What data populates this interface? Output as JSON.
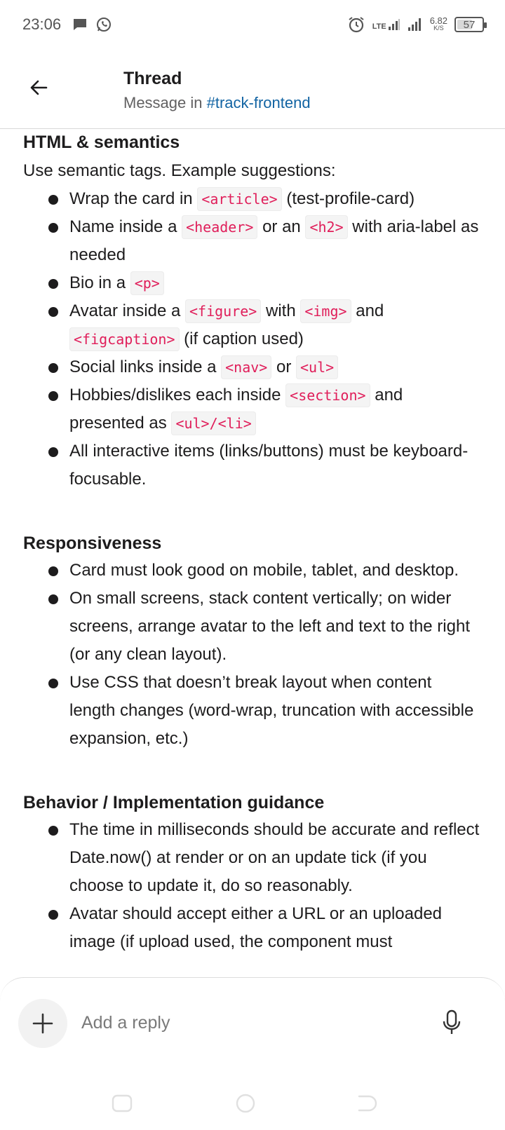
{
  "status_bar": {
    "time": "23:06",
    "network_label": "LTE",
    "net_speed_value": "6.82",
    "net_speed_unit": "K/S",
    "battery": "57",
    "icons": [
      "chat-bubble-icon",
      "whatsapp-icon",
      "alarm-icon",
      "lte-signal-icon",
      "signal-icon",
      "battery-icon"
    ]
  },
  "header": {
    "title": "Thread",
    "subtitle_prefix": "Message in ",
    "channel": "#track-frontend"
  },
  "message": {
    "sections": [
      {
        "title": "HTML & semantics",
        "intro": "Use semantic tags. Example suggestions:",
        "items": [
          {
            "t1": "Wrap the card in ",
            "c1": "<article>",
            "t2": " (test-profile-card)"
          },
          {
            "t1": "Name inside a ",
            "c1": "<header>",
            "t2": " or an ",
            "c2": "<h2>",
            "t3": " with aria-label as needed"
          },
          {
            "t1": "Bio in a ",
            "c1": "<p>"
          },
          {
            "t1": "Avatar inside a ",
            "c1": "<figure>",
            "t2": " with ",
            "c2": "<img>",
            "t3": " and ",
            "c3": "<figcaption>",
            "t4": " (if caption used)"
          },
          {
            "t1": "Social links inside a ",
            "c1": "<nav>",
            "t2": " or ",
            "c2": "<ul>"
          },
          {
            "t1": "Hobbies/dislikes each inside ",
            "c1": "<section>",
            "t2": " and presented as ",
            "c2": "<ul>/<li>"
          },
          {
            "t1": "All interactive items (links/buttons) must be keyboard-focusable."
          }
        ]
      },
      {
        "title": "Responsiveness",
        "items": [
          {
            "t1": "Card must look good on mobile, tablet, and desktop."
          },
          {
            "t1": "On small screens, stack content vertically; on wider screens, arrange avatar to the left and text to the right (or any clean layout)."
          },
          {
            "t1": "Use CSS that doesn’t break layout when content length changes (word-wrap, truncation with accessible expansion, etc.)"
          }
        ]
      },
      {
        "title": "Behavior / Implementation guidance",
        "items": [
          {
            "t1": "The time in milliseconds should be accurate and reflect Date.now() at render or on an update tick (if you choose to update it, do so reasonably."
          },
          {
            "t1": "Avatar should accept either a URL or an uploaded image (if upload used, the component must"
          }
        ]
      }
    ]
  },
  "composer": {
    "placeholder": "Add a reply"
  },
  "colors": {
    "code_text": "#e01e5a",
    "link": "#1264a3",
    "text": "#1d1c1d",
    "muted": "#616061"
  }
}
